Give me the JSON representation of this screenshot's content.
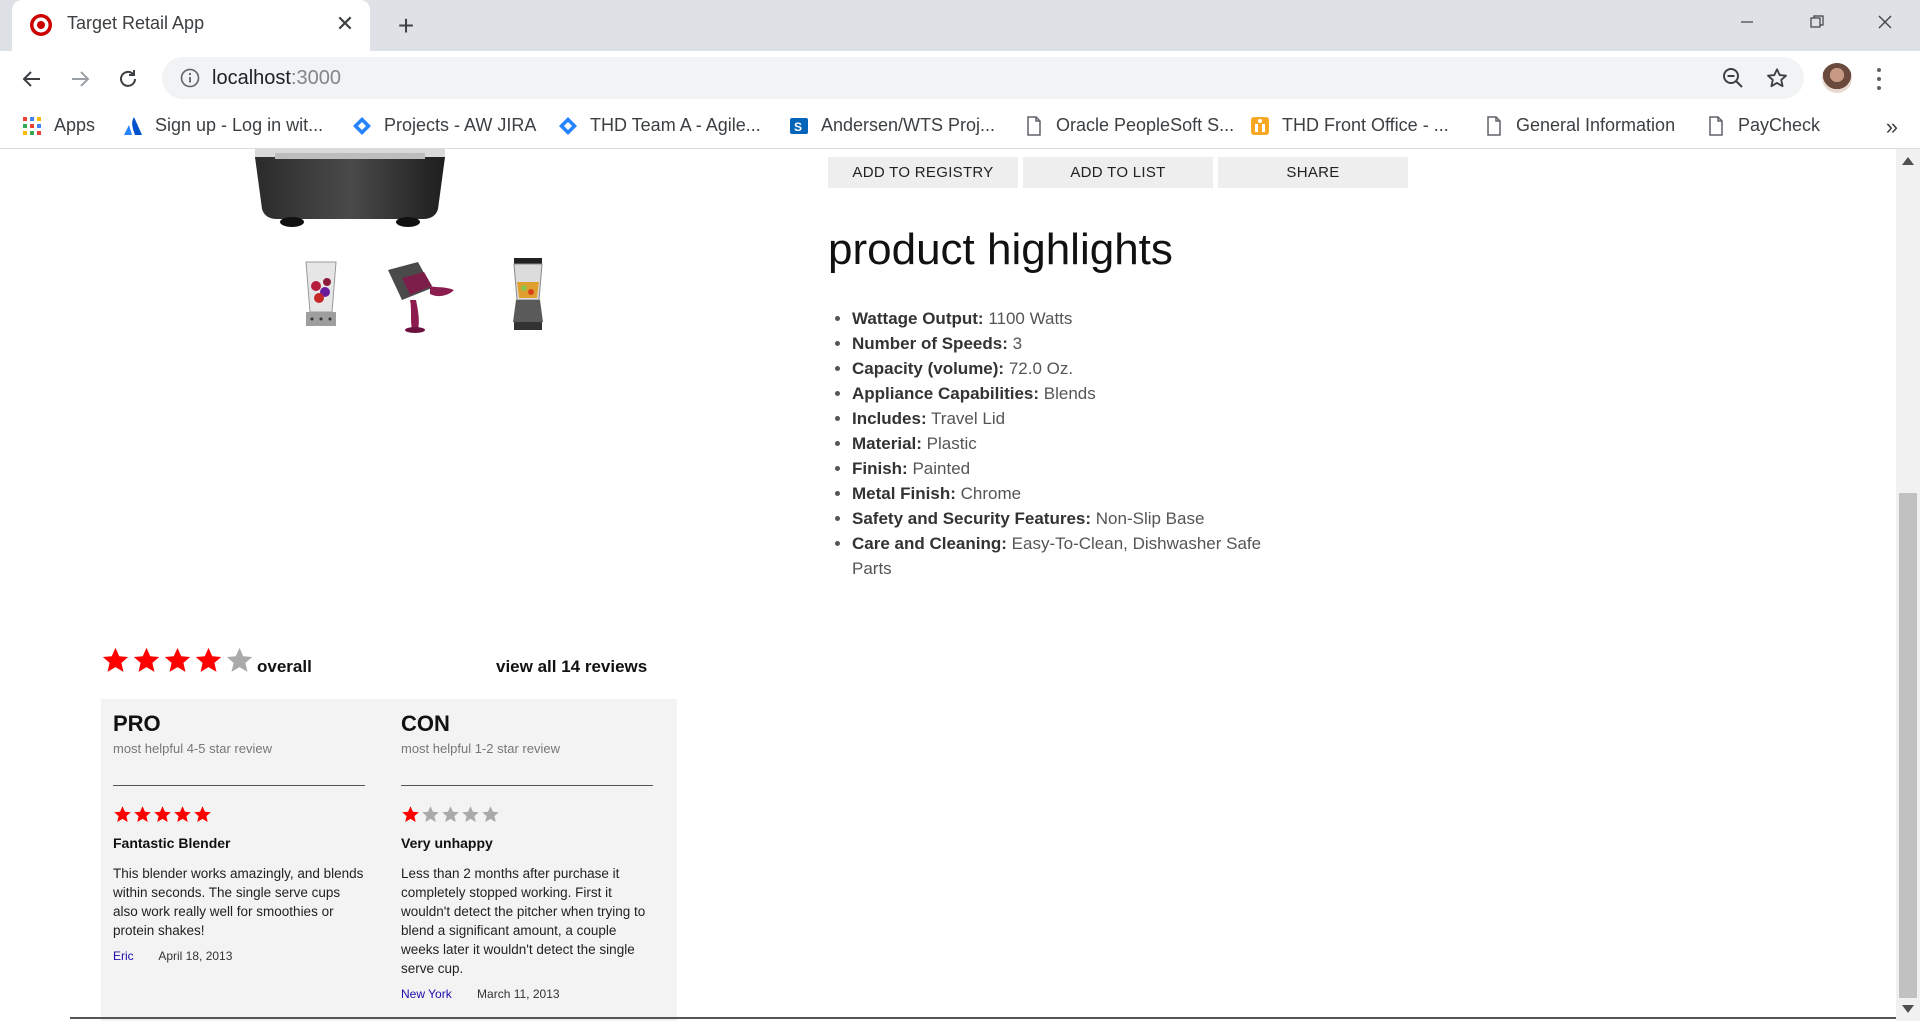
{
  "browser": {
    "tab_title": "Target Retail App",
    "url_host": "localhost",
    "url_port": ":3000",
    "bookmarks": [
      {
        "label": "Apps",
        "icon": "apps-grid-icon"
      },
      {
        "label": "Sign up - Log in wit...",
        "icon": "atlassian-icon"
      },
      {
        "label": "Projects - AW JIRA",
        "icon": "jira-icon"
      },
      {
        "label": "THD Team A - Agile...",
        "icon": "jira-icon"
      },
      {
        "label": "Andersen/WTS Proj...",
        "icon": "sharepoint-icon"
      },
      {
        "label": "Oracle PeopleSoft S...",
        "icon": "page-icon"
      },
      {
        "label": "THD Front Office - ...",
        "icon": "office-app-icon"
      },
      {
        "label": "General Information",
        "icon": "page-icon"
      },
      {
        "label": "PayCheck",
        "icon": "page-icon"
      }
    ]
  },
  "actions": {
    "add_to_registry": "ADD TO REGISTRY",
    "add_to_list": "ADD TO LIST",
    "share": "SHARE"
  },
  "highlights": {
    "title": "product highlights",
    "items": [
      {
        "label": "Wattage Output:",
        "value": "1100 Watts"
      },
      {
        "label": "Number of Speeds:",
        "value": "3"
      },
      {
        "label": "Capacity (volume):",
        "value": "72.0 Oz."
      },
      {
        "label": "Appliance Capabilities:",
        "value": "Blends"
      },
      {
        "label": "Includes:",
        "value": "Travel Lid"
      },
      {
        "label": "Material:",
        "value": "Plastic"
      },
      {
        "label": "Finish:",
        "value": "Painted"
      },
      {
        "label": "Metal Finish:",
        "value": "Chrome"
      },
      {
        "label": "Safety and Security Features:",
        "value": "Non-Slip Base"
      },
      {
        "label": "Care and Cleaning:",
        "value": "Easy-To-Clean, Dishwasher Safe Parts"
      }
    ]
  },
  "reviews": {
    "overall_rating": 4,
    "max_rating": 5,
    "overall_label": "overall",
    "view_all_label": "view all 14 reviews",
    "star_color": "#ff0000",
    "star_empty_color": "#aaaaaa",
    "pro": {
      "heading": "PRO",
      "subheading": "most helpful 4-5 star review",
      "rating": 5,
      "title": "Fantastic Blender",
      "body": "This blender works amazingly, and blends within seconds. The single serve cups also work really well for smoothies or protein shakes!",
      "author": "Eric",
      "date": "April 18, 2013"
    },
    "con": {
      "heading": "CON",
      "subheading": "most helpful 1-2 star review",
      "rating": 1,
      "title": "Very unhappy",
      "body": "Less than 2 months after purchase it completely stopped working. First it wouldn't detect the pitcher when trying to blend a significant amount, a couple weeks later it wouldn't detect the single serve cup.",
      "author": "New York",
      "date": "March 11, 2013"
    }
  }
}
